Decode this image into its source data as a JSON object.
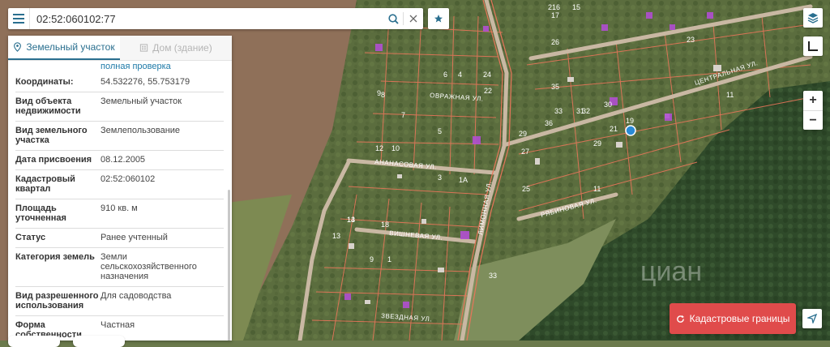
{
  "search": {
    "value": "02:52:060102:77"
  },
  "tabs": [
    {
      "label": "Земельный участок"
    },
    {
      "label": "Дом (здание)"
    }
  ],
  "panel": {
    "partial_link": "полная проверка",
    "rows": [
      {
        "key": "Координаты:",
        "value": "54.532276, 55.753179"
      },
      {
        "key": "Вид объекта недвижимости",
        "value": "Земельный участок"
      },
      {
        "key": "Вид земельного участка",
        "value": "Землепользование"
      },
      {
        "key": "Дата присвоения",
        "value": "08.12.2005"
      },
      {
        "key": "Кадастровый квартал",
        "value": "02:52:060102"
      },
      {
        "key": "Площадь уточненная",
        "value": "910 кв. м"
      },
      {
        "key": "Статус",
        "value": "Ранее учтенный"
      },
      {
        "key": "Категория земель",
        "value": "Земли сельскохозяйственного назначения"
      },
      {
        "key": "Вид разрешенного использования",
        "value": "Для садоводства"
      },
      {
        "key": "Форма собственности",
        "value": "Частная"
      }
    ]
  },
  "map": {
    "streets": [
      "Овражная ул.",
      "Центральная ул.",
      "Ананасовая ул.",
      "Вишневая ул.",
      "Звездная ул.",
      "Рябиновая ул.",
      "Лимонная ул."
    ],
    "plot_numbers": [
      "216",
      "17",
      "15",
      "1",
      "6",
      "4",
      "22",
      "8",
      "30",
      "26",
      "23",
      "21",
      "35",
      "33",
      "31",
      "24",
      "9",
      "7",
      "5",
      "3",
      "12",
      "10",
      "1А",
      "29",
      "27",
      "25",
      "36",
      "32",
      "19",
      "29",
      "11",
      "13",
      "14",
      "33",
      "9",
      "1",
      "13",
      "18",
      "11"
    ],
    "watermark": "циан"
  },
  "controls": {
    "zoom_in": "+",
    "zoom_out": "−",
    "cadastral_label": "Кадастровые границы"
  },
  "colors": {
    "accent": "#2a6f8f",
    "cadastral_button": "#e04b4b",
    "parcel_lines": "#e8755a",
    "marker": "#2a8ad6"
  }
}
